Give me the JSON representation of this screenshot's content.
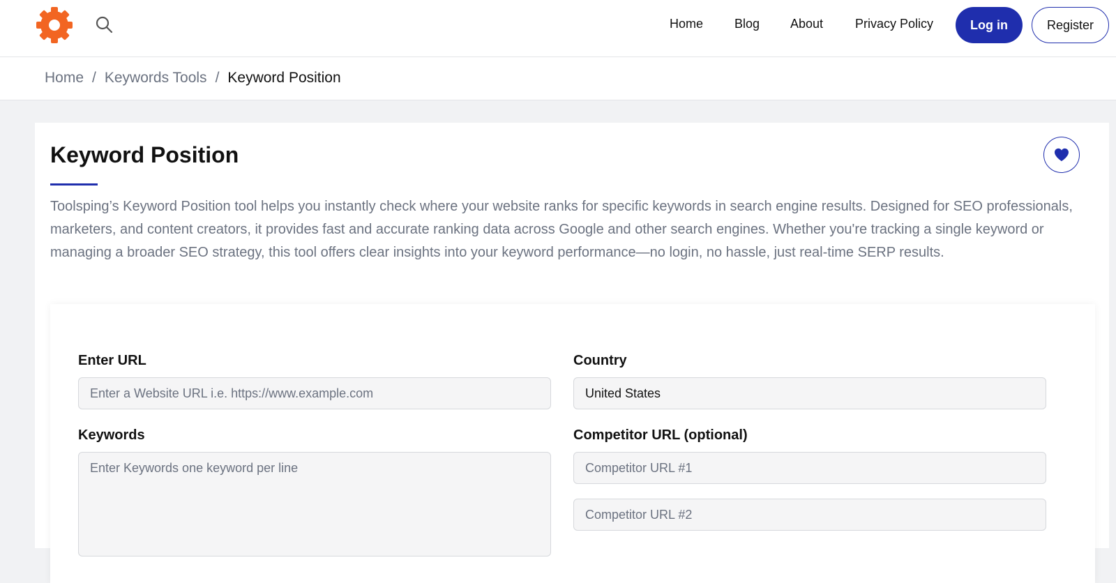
{
  "colors": {
    "brand": "#1f2ead",
    "logo": "#f26522"
  },
  "header": {
    "logo_icon": "gear-logo-icon",
    "search_icon": "search-icon",
    "nav": {
      "home": "Home",
      "blog": "Blog",
      "about": "About",
      "privacy": "Privacy Policy"
    },
    "login_label": "Log in",
    "register_label": "Register"
  },
  "breadcrumb": {
    "items": [
      "Home",
      "Keywords Tools"
    ],
    "separator": "/",
    "current": "Keyword Position"
  },
  "page": {
    "title": "Keyword Position",
    "favorite_icon": "heart-icon",
    "description": "Toolsping’s Keyword Position tool helps you instantly check where your website ranks for specific keywords in search engine results. Designed for SEO professionals, marketers, and content creators, it provides fast and accurate ranking data across Google and other search engines. Whether you're tracking a single keyword or managing a broader SEO strategy, this tool offers clear insights into your keyword performance—no login, no hassle, just real-time SERP results."
  },
  "form": {
    "url_label": "Enter URL",
    "url_placeholder": "Enter a Website URL i.e. https://www.example.com",
    "country_label": "Country",
    "country_value": "United States",
    "keywords_label": "Keywords",
    "keywords_placeholder": "Enter Keywords one keyword per line",
    "competitor_label": "Competitor URL (optional)",
    "competitor1_placeholder": "Competitor URL #1",
    "competitor2_placeholder": "Competitor URL #2"
  }
}
